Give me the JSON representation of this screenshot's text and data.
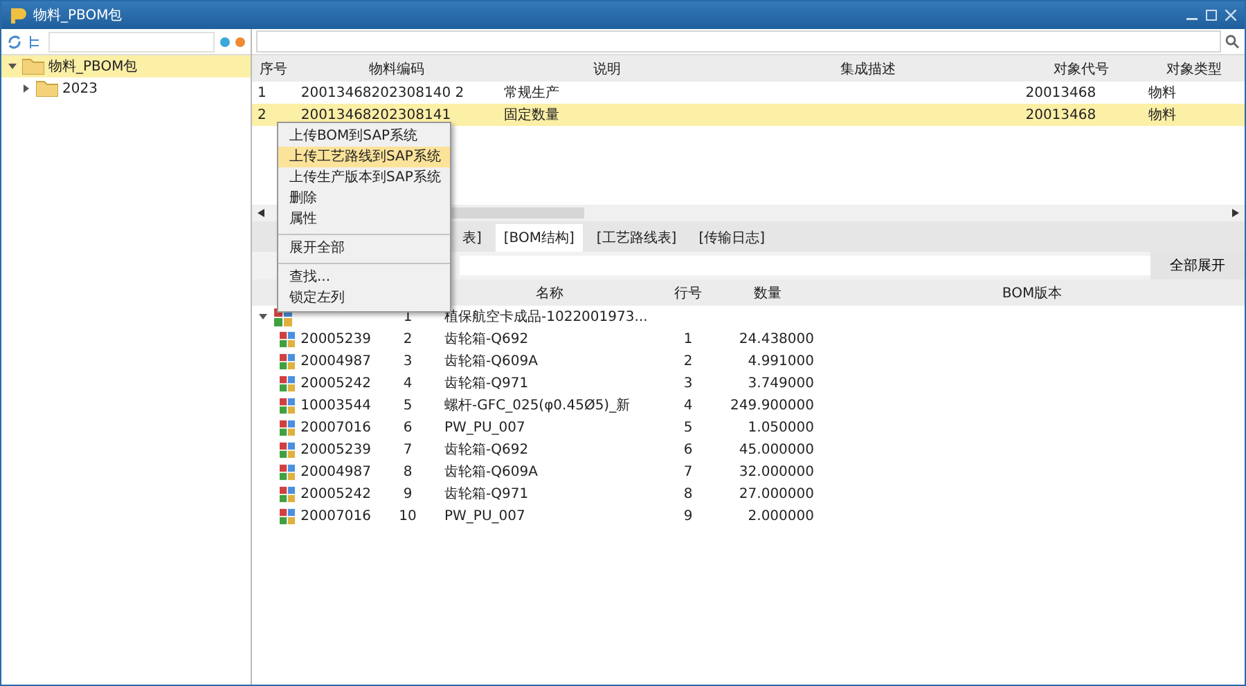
{
  "window": {
    "title": "物料_PBOM包"
  },
  "sidebar": {
    "tree": [
      {
        "label": "物料_PBOM包",
        "selected": true,
        "expanded": true,
        "children": [
          {
            "label": "2023",
            "selected": false,
            "expanded": false
          }
        ]
      }
    ]
  },
  "upper_table": {
    "columns": [
      "序号",
      "物料编码",
      "说明",
      "集成描述",
      "对象代号",
      "对象类型"
    ],
    "rows": [
      {
        "cells": [
          "1",
          "20013468202308140 2",
          "常规生产",
          "",
          "20013468",
          "物料"
        ],
        "selected": false
      },
      {
        "cells": [
          "2",
          "20013468202308141",
          "固定数量",
          "",
          "20013468",
          "物料"
        ],
        "selected": true
      }
    ]
  },
  "context_menu": {
    "items": [
      {
        "label": "上传BOM到SAP系统",
        "selected": false,
        "separator_before": false
      },
      {
        "label": "上传工艺路线到SAP系统",
        "selected": true,
        "separator_before": false
      },
      {
        "label": "上传生产版本到SAP系统",
        "selected": false,
        "separator_before": false
      },
      {
        "label": "删除",
        "selected": false,
        "separator_before": false
      },
      {
        "label": "属性",
        "selected": false,
        "separator_before": false
      },
      {
        "label": "展开全部",
        "selected": false,
        "separator_before": true
      },
      {
        "label": "查找...",
        "selected": false,
        "separator_before": true
      },
      {
        "label": "锁定左列",
        "selected": false,
        "separator_before": false
      }
    ]
  },
  "tabs": [
    {
      "label": "表]",
      "selected": false
    },
    {
      "label": "[BOM结构]",
      "selected": true
    },
    {
      "label": "[工艺路线表]",
      "selected": false
    },
    {
      "label": "[传输日志]",
      "selected": false
    }
  ],
  "expand_all_button": "全部展开",
  "lower_table": {
    "columns": [
      "名称",
      "行号",
      "数量",
      "BOM版本"
    ],
    "root": {
      "seq": "1",
      "name": "植保航空卡成品-1022001973...",
      "expanded": true
    },
    "rows": [
      {
        "code": "20005239",
        "seq": "2",
        "name": "齿轮箱-Q692",
        "line": "1",
        "qty": "24.438000"
      },
      {
        "code": "20004987",
        "seq": "3",
        "name": "齿轮箱-Q609A",
        "line": "2",
        "qty": "4.991000"
      },
      {
        "code": "20005242",
        "seq": "4",
        "name": "齿轮箱-Q971",
        "line": "3",
        "qty": "3.749000"
      },
      {
        "code": "10003544",
        "seq": "5",
        "name": "螺杆-GFC_025(φ0.45Ø5)_新",
        "line": "4",
        "qty": "249.900000"
      },
      {
        "code": "20007016",
        "seq": "6",
        "name": "PW_PU_007",
        "line": "5",
        "qty": "1.050000"
      },
      {
        "code": "20005239",
        "seq": "7",
        "name": "齿轮箱-Q692",
        "line": "6",
        "qty": "45.000000"
      },
      {
        "code": "20004987",
        "seq": "8",
        "name": "齿轮箱-Q609A",
        "line": "7",
        "qty": "32.000000"
      },
      {
        "code": "20005242",
        "seq": "9",
        "name": "齿轮箱-Q971",
        "line": "8",
        "qty": "27.000000"
      },
      {
        "code": "20007016",
        "seq": "10",
        "name": "PW_PU_007",
        "line": "9",
        "qty": "2.000000"
      }
    ]
  }
}
